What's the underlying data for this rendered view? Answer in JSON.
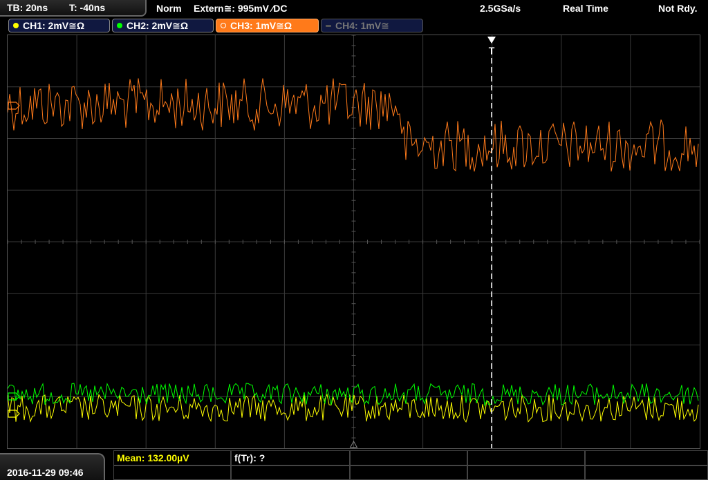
{
  "status": {
    "timebase": "TB: 20ns",
    "trigger_time": "T: -40ns",
    "mode": "Norm",
    "trigger_source": "Extern≅: 995mV ⁄DC",
    "sample_rate": "2.5GSa/s",
    "acq_mode": "Real Time",
    "state": "Not Rdy."
  },
  "channels": [
    {
      "label": "CH1: 2mV≅Ω",
      "color": "#ffff00",
      "active": true
    },
    {
      "label": "CH2: 2mV≅Ω",
      "color": "#00ff00",
      "active": true
    },
    {
      "label": "CH3: 1mV≅Ω",
      "color": "#ff7a1a",
      "active": true,
      "selected": true
    },
    {
      "label": "CH4: 1mV≅",
      "color": "#888888",
      "active": false
    }
  ],
  "trigger_marker": "T",
  "datetime": "2016-11-29 09:46",
  "measurements": {
    "mean": "Mean: 132.00µV",
    "ftr": "f(Tr): ?"
  },
  "colors": {
    "ch1": "#ffff00",
    "ch2": "#00ff00",
    "ch3": "#ff7a1a",
    "grid": "#3a3a3a"
  }
}
